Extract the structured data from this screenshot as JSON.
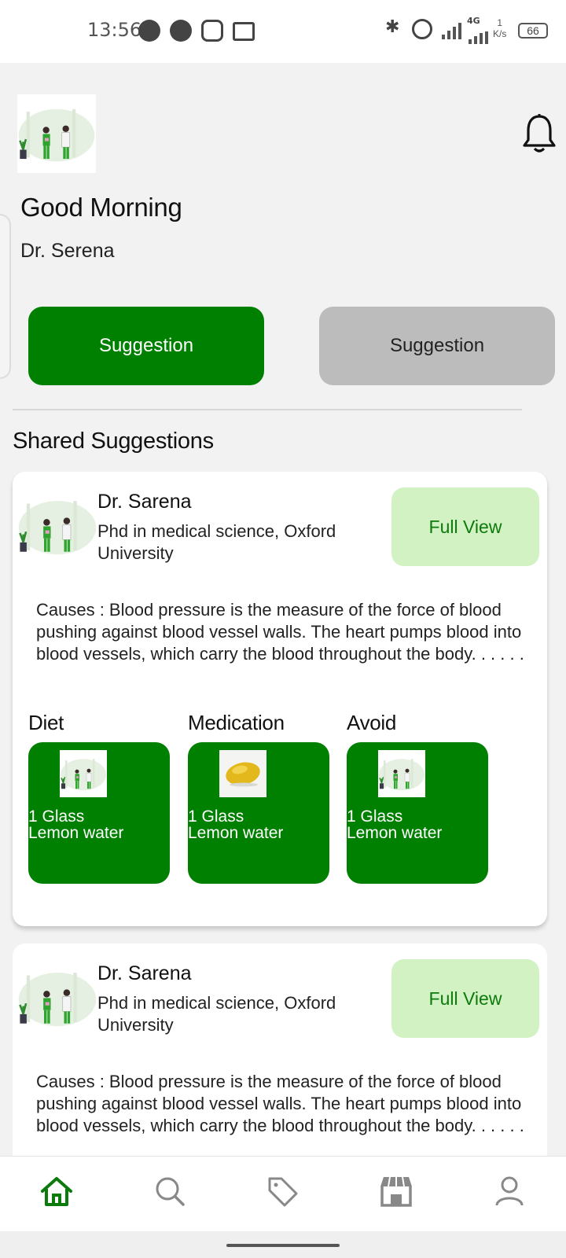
{
  "status_bar": {
    "time": "13:56",
    "network": "4G",
    "speed_value": "1",
    "speed_unit": "K/s",
    "battery": "66"
  },
  "header": {
    "greeting": "Good Morning",
    "doctor_name": "Dr. Serena"
  },
  "tabs": [
    {
      "label": "Suggestion",
      "active": true
    },
    {
      "label": "Suggestion",
      "active": false
    }
  ],
  "section_title": "Shared Suggestions",
  "cards": [
    {
      "doctor": "Dr. Sarena",
      "credentials": "Phd in medical science, Oxford University",
      "full_view_label": "Full View",
      "causes": "Causes : Blood pressure is the measure of the force of blood pushing against blood vessel walls. The heart pumps blood into blood vessels, which carry the blood throughout the body. . . . . .",
      "columns": [
        {
          "label": "Diet",
          "line1": "1 Glass",
          "line2": "Lemon water",
          "image": "doctors-illustration"
        },
        {
          "label": "Medication",
          "line1": "1 Glass",
          "line2": "Lemon water",
          "image": "lemon-photo"
        },
        {
          "label": "Avoid",
          "line1": "1 Glass",
          "line2": "Lemon water",
          "image": "doctors-illustration"
        }
      ]
    },
    {
      "doctor": "Dr. Sarena",
      "credentials": "Phd in medical science, Oxford University",
      "full_view_label": "Full View",
      "causes": "Causes : Blood pressure is the measure of the force of blood pushing against blood vessel walls. The heart pumps blood into blood vessels, which carry the blood throughout the body. . . . . ."
    }
  ],
  "bottom_nav": [
    {
      "name": "home-icon",
      "active": true
    },
    {
      "name": "search-icon",
      "active": false
    },
    {
      "name": "tag-icon",
      "active": false
    },
    {
      "name": "store-icon",
      "active": false
    },
    {
      "name": "profile-icon",
      "active": false
    }
  ],
  "colors": {
    "primary_green": "#008000",
    "light_green": "#d2f2c3",
    "inactive_grey": "#bdbcbd",
    "background": "#f2f2f2"
  }
}
